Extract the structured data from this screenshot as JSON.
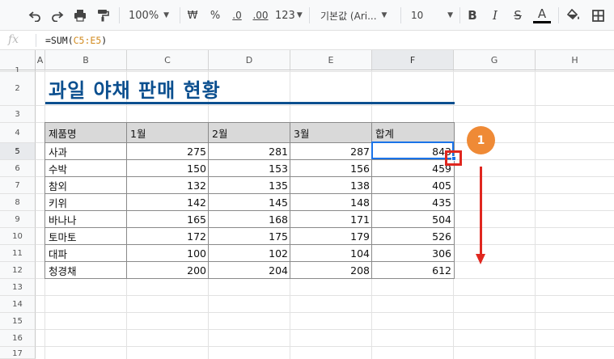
{
  "toolbar": {
    "zoom": "100%",
    "currency": "₩",
    "percent": "%",
    "decrease_decimals": ".0",
    "increase_decimals": ".00",
    "more_formats": "123",
    "font_name": "기본값 (Ari...",
    "font_size": "10",
    "bold": "B",
    "italic": "I",
    "strikethrough": "S",
    "text_color": "A"
  },
  "formula_bar": {
    "fx_label": "fx",
    "prefix": "=SUM(",
    "ref": "C5:E5",
    "suffix": ")"
  },
  "columns": [
    "A",
    "B",
    "C",
    "D",
    "E",
    "F",
    "G",
    "H"
  ],
  "rows": [
    "1",
    "2",
    "3",
    "4",
    "5",
    "6",
    "7",
    "8",
    "9",
    "10",
    "11",
    "12",
    "13",
    "14",
    "15",
    "16",
    "17"
  ],
  "sheet": {
    "title": "과일 야채 판매 현황",
    "headers": [
      "제품명",
      "1월",
      "2월",
      "3월",
      "합계"
    ],
    "data": [
      [
        "사과",
        "275",
        "281",
        "287",
        "843"
      ],
      [
        "수박",
        "150",
        "153",
        "156",
        "459"
      ],
      [
        "참외",
        "132",
        "135",
        "138",
        "405"
      ],
      [
        "키위",
        "142",
        "145",
        "148",
        "435"
      ],
      [
        "바나나",
        "165",
        "168",
        "171",
        "504"
      ],
      [
        "토마토",
        "172",
        "175",
        "179",
        "526"
      ],
      [
        "대파",
        "100",
        "102",
        "104",
        "306"
      ],
      [
        "청경채",
        "200",
        "204",
        "208",
        "612"
      ]
    ]
  },
  "annotation": {
    "step_number": "1",
    "color": "#e0271f",
    "badge_color": "#ef8a36"
  }
}
